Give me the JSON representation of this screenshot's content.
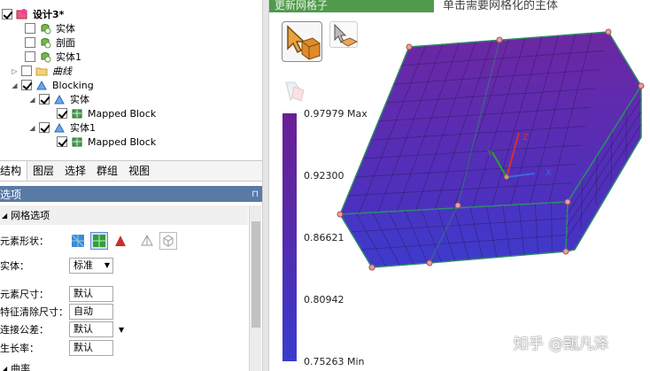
{
  "tree": {
    "root": "设计3*",
    "items": [
      {
        "label": "实体"
      },
      {
        "label": "剖面"
      },
      {
        "label": "实体1"
      },
      {
        "label": "曲线"
      },
      {
        "label": "Blocking"
      },
      {
        "label": "实体"
      },
      {
        "label": "Mapped Block"
      },
      {
        "label": "实体1"
      },
      {
        "label": "Mapped Block"
      }
    ]
  },
  "tabs": [
    "结构",
    "图层",
    "选择",
    "群组",
    "视图"
  ],
  "options": {
    "header": "选项",
    "mesh_options": "网格选项",
    "element_shape_label": "元素形状：",
    "body_label": "实体：",
    "body_value": "标准",
    "element_size_label": "元素尺寸：",
    "element_size_value": "默认",
    "feature_size_label": "特征清除尺寸：",
    "feature_size_value": "自动",
    "tolerance_label": "连接公差：",
    "tolerance_value": "默认",
    "growth_label": "生长率：",
    "growth_value": "默认",
    "next_section": "曲率"
  },
  "right": {
    "panel_title": "更新网格子",
    "hint": "单击需要网格化的主体",
    "legend": {
      "max": "0.97979 Max",
      "v2": "0.92300",
      "v3": "0.86621",
      "v4": "0.80942",
      "min": "0.75263 Min"
    },
    "axes": {
      "x": "X",
      "y": "Y",
      "z": "Z"
    },
    "watermark": "知乎 @甄凡泽"
  },
  "colors": {
    "header_green": "#4f9a4c",
    "options_header": "#5a7aa6",
    "mesh_top": "#6a2aa8",
    "mesh_side": "#4e30c0",
    "mesh_edge": "#2f8a6a"
  }
}
